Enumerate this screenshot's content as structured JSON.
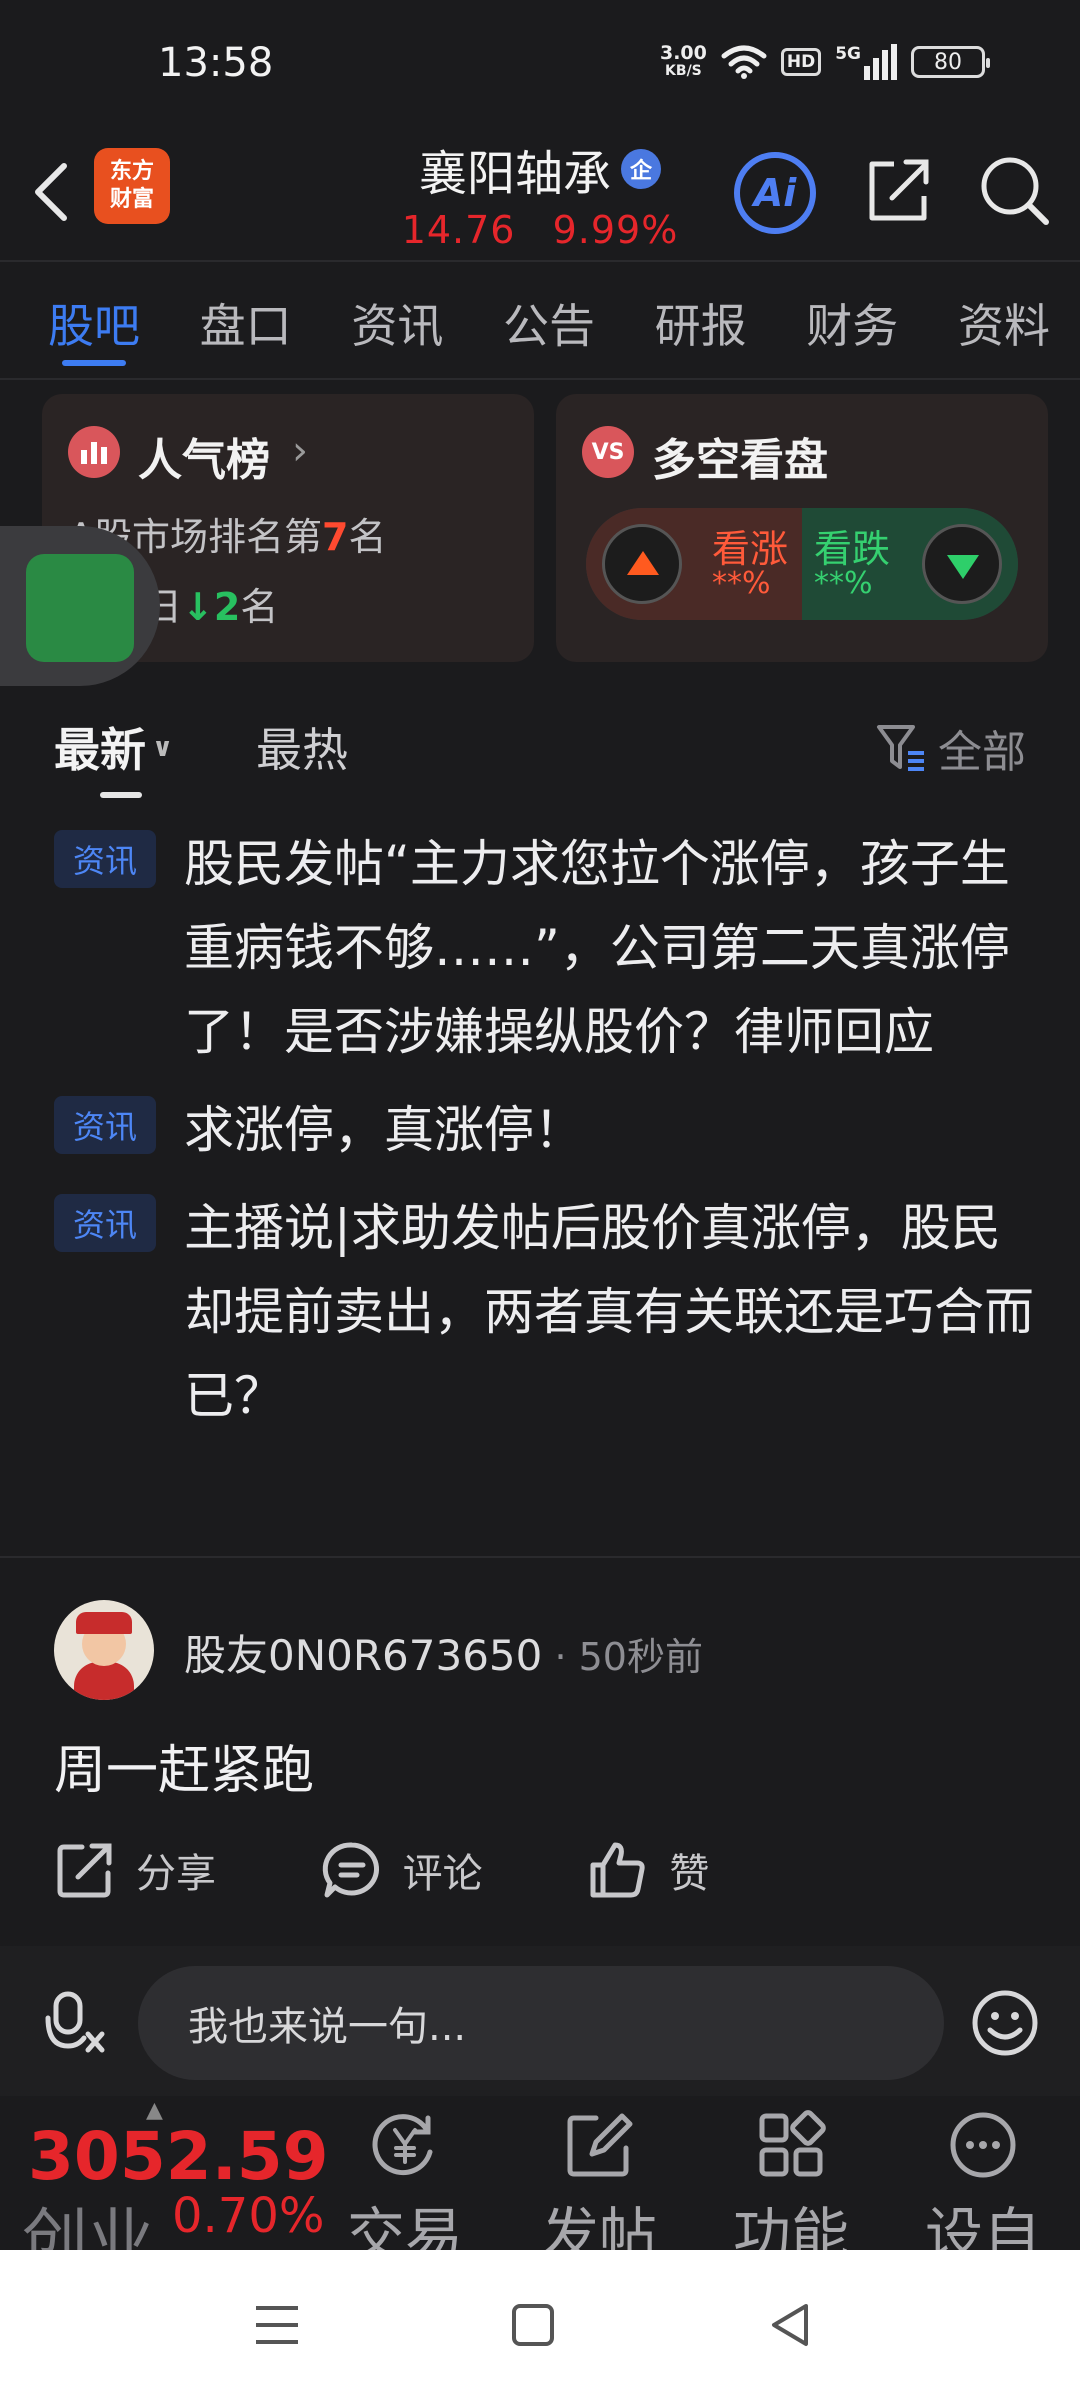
{
  "status_bar": {
    "time": "13:58",
    "net_speed_value": "3.00",
    "net_speed_unit": "KB/S",
    "hd": "HD",
    "signal": "5G",
    "battery": "80"
  },
  "header": {
    "brand_line1": "东方",
    "brand_line2": "财富",
    "stock_name": "襄阳轴承",
    "badge": "企",
    "price": "14.76",
    "change_pct": "9.99%",
    "ai_label": "Ai"
  },
  "tabs": [
    {
      "label": "股吧",
      "active": true
    },
    {
      "label": "盘口"
    },
    {
      "label": "资讯"
    },
    {
      "label": "公告"
    },
    {
      "label": "研报"
    },
    {
      "label": "财务"
    },
    {
      "label": "资料"
    }
  ],
  "popularity_card": {
    "title": "人气榜",
    "chevron": "›",
    "rank_prefix": "A股市场排名第",
    "rank_value": "7",
    "rank_suffix": "名",
    "change_prefix": "较昨日",
    "change_arrow": "↓",
    "change_value": "2",
    "change_suffix": "名"
  },
  "longshort_card": {
    "icon_text": "VS",
    "title": "多空看盘",
    "up_label": "看涨",
    "up_pct": "**%",
    "down_label": "看跌",
    "down_pct": "**%"
  },
  "sort": {
    "latest": "最新",
    "hot": "最热",
    "filter": "全部"
  },
  "news": [
    {
      "tag": "资讯",
      "text": "股民发帖“主力求您拉个涨停，孩子生重病钱不够……”，公司第二天真涨停了！是否涉嫌操纵股价？律师回应"
    },
    {
      "tag": "资讯",
      "text": "求涨停，真涨停！"
    },
    {
      "tag": "资讯",
      "text": "主播说|求助发帖后股价真涨停，股民却提前卖出，两者真有关联还是巧合而已？"
    }
  ],
  "post": {
    "username": "股友0N0R673650",
    "time": " · 50秒前",
    "body": "周一赶紧跑",
    "share": "分享",
    "comment": "评论",
    "like": "赞"
  },
  "comment_bar": {
    "placeholder": "我也来说一句..."
  },
  "bottom_nav": {
    "index_value": "3052.59",
    "index_name": "创业",
    "index_change": "0.70%",
    "items": [
      {
        "label": "交易",
        "icon": "yen-cycle-icon"
      },
      {
        "label": "发帖",
        "icon": "edit-icon"
      },
      {
        "label": "功能",
        "icon": "grid-icon"
      },
      {
        "label": "设自",
        "icon": "more-icon"
      }
    ]
  },
  "colors": {
    "accent_blue": "#3d7cf2",
    "rise_red": "#e6262b",
    "fall_green": "#28c060",
    "background": "#1b1b1d"
  }
}
